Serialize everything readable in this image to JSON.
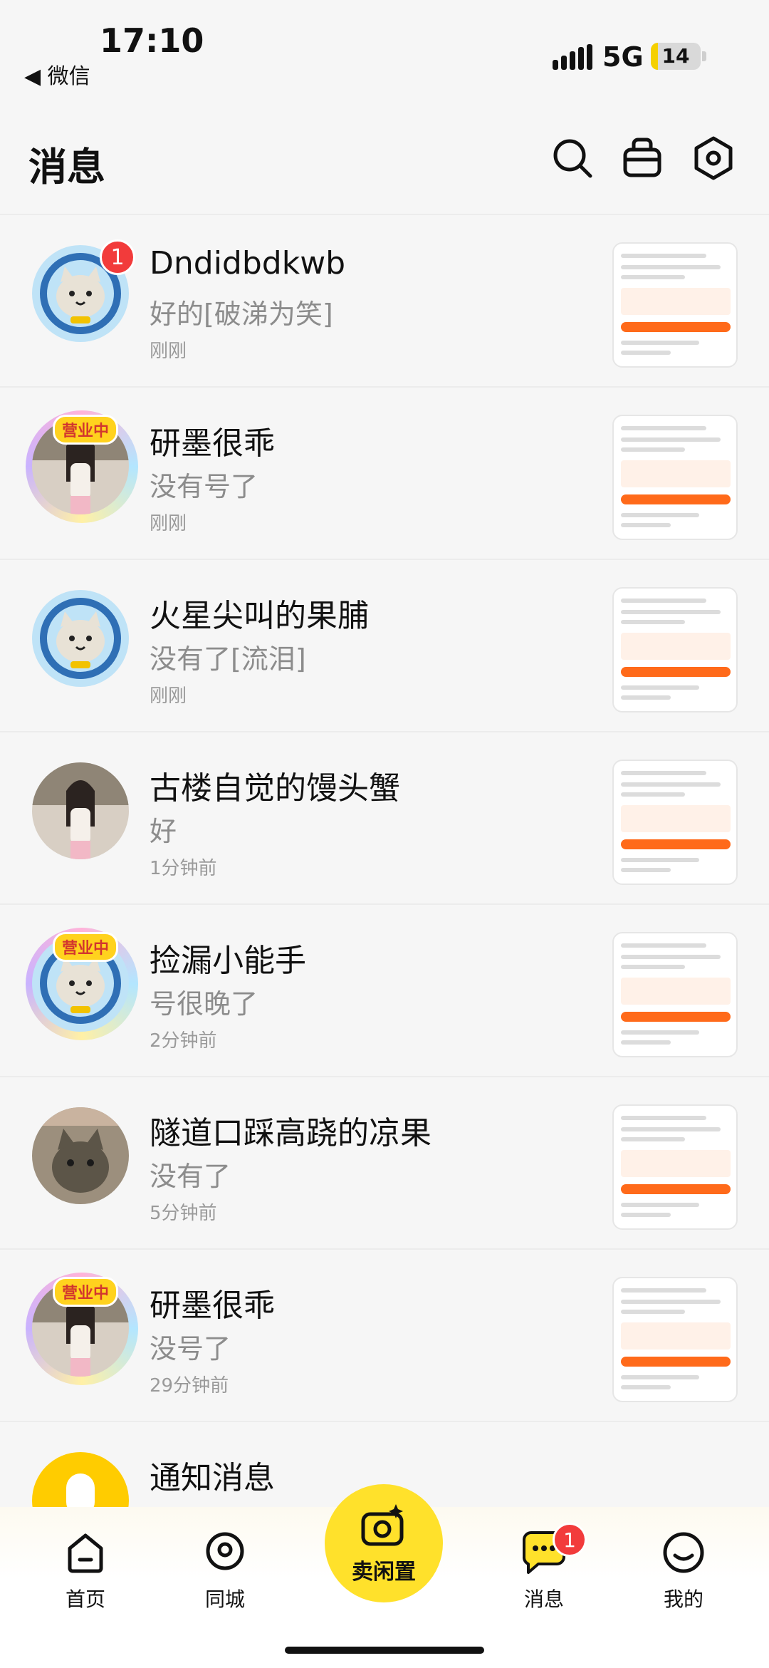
{
  "status_bar": {
    "time": "17:10",
    "back_app": "◀ 微信",
    "network": "5G",
    "battery_level": "14",
    "battery_fraction": 0.14
  },
  "header": {
    "title": "消息",
    "icons": [
      "search-icon",
      "shop-bag-icon",
      "settings-icon"
    ]
  },
  "conversations": [
    {
      "name": "Dndidbdkwb",
      "message": "好的[破涕为笑]",
      "time": "刚刚",
      "unread": "1",
      "avatar": "cat-astronaut",
      "badge": ""
    },
    {
      "name": "研墨很乖",
      "message": "没有号了",
      "time": "刚刚",
      "unread": "",
      "avatar": "girl-photo",
      "badge": "营业中"
    },
    {
      "name": "火星尖叫的果脯",
      "message": "没有了[流泪]",
      "time": "刚刚",
      "unread": "",
      "avatar": "cat-astronaut",
      "badge": ""
    },
    {
      "name": "古楼自觉的馒头蟹",
      "message": "好",
      "time": "1分钟前",
      "unread": "",
      "avatar": "girl-photo",
      "badge": ""
    },
    {
      "name": "捡漏小能手",
      "message": "号很晚了",
      "time": "2分钟前",
      "unread": "",
      "avatar": "cat-astronaut",
      "badge": "营业中"
    },
    {
      "name": "隧道口踩高跷的凉果",
      "message": "没有了",
      "time": "5分钟前",
      "unread": "",
      "avatar": "cat-photo",
      "badge": ""
    },
    {
      "name": "研墨很乖",
      "message": "没号了",
      "time": "29分钟前",
      "unread": "",
      "avatar": "girl-photo",
      "badge": "营业中"
    },
    {
      "name": "通知消息",
      "message": "",
      "time": "",
      "unread": "",
      "avatar": "notification-bell",
      "badge": ""
    }
  ],
  "bottom_nav": {
    "items": [
      {
        "label": "首页",
        "icon": "home-icon"
      },
      {
        "label": "同城",
        "icon": "location-icon"
      },
      {
        "label": "卖闲置",
        "icon": "camera-sparkle-icon"
      },
      {
        "label": "消息",
        "icon": "chat-bubble-icon",
        "badge": "1"
      },
      {
        "label": "我的",
        "icon": "smile-face-icon"
      }
    ]
  },
  "colors": {
    "accent_yellow": "#ffe12b",
    "badge_red": "#f23b3b",
    "orange": "#ff6a1a"
  }
}
